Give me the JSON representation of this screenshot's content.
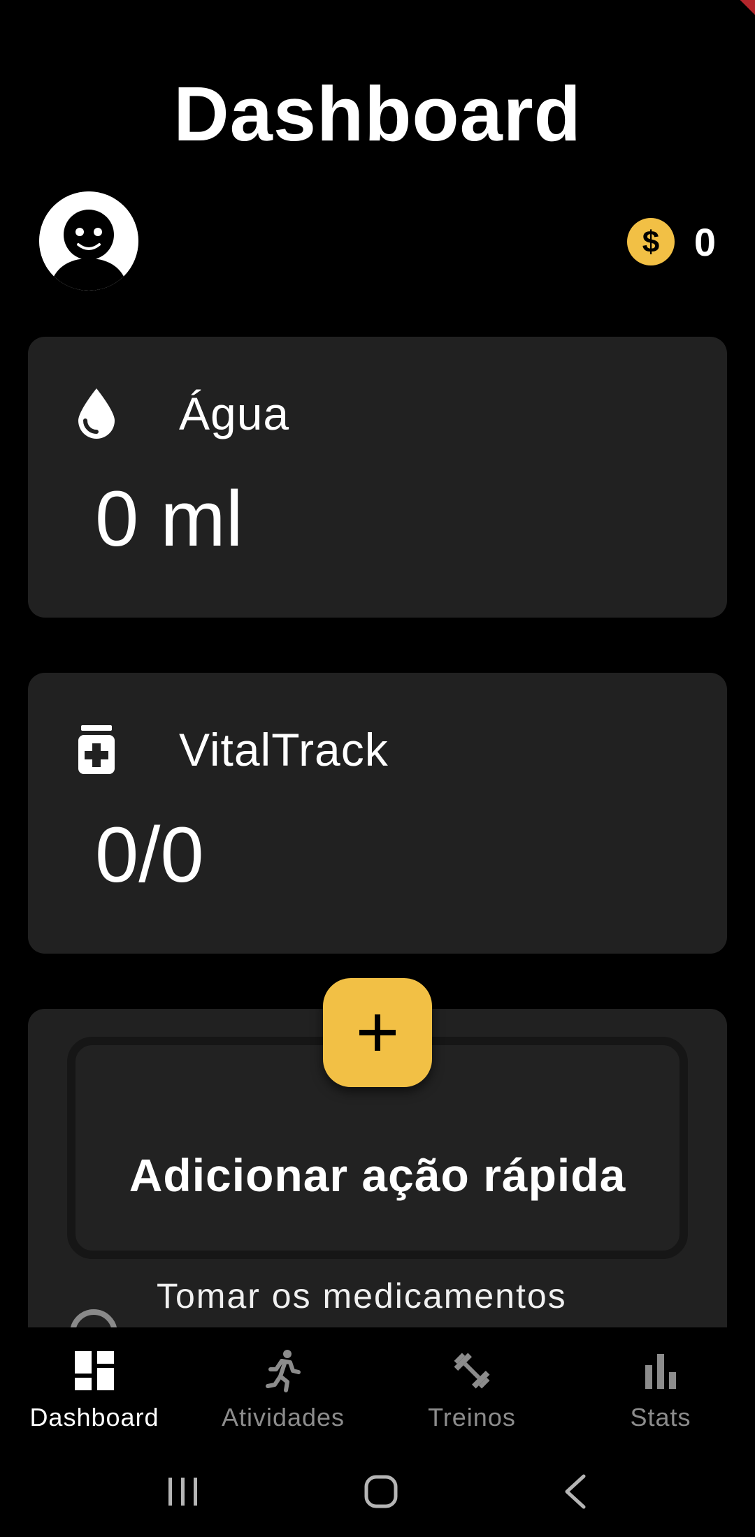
{
  "header": {
    "title": "Dashboard"
  },
  "profile": {
    "avatar_icon": "face-avatar-icon"
  },
  "coins": {
    "icon": "dollar-coin-icon",
    "count": "0",
    "color": "#f2c045"
  },
  "cards": {
    "water": {
      "icon": "water-drop-icon",
      "title": "Água",
      "value": "0 ml"
    },
    "meds": {
      "icon": "medication-icon",
      "title": "VitalTrack",
      "value": "0/0"
    }
  },
  "quick_actions": {
    "add_label": "Adicionar ação rápida",
    "fab_icon": "plus-icon",
    "tasks": [
      {
        "label": "Tomar os medicamentos",
        "checked": false
      }
    ]
  },
  "bottom_nav": {
    "items": [
      {
        "label": "Dashboard",
        "icon": "dashboard-icon",
        "active": true
      },
      {
        "label": "Atividades",
        "icon": "running-icon",
        "active": false
      },
      {
        "label": "Treinos",
        "icon": "dumbbell-icon",
        "active": false
      },
      {
        "label": "Stats",
        "icon": "bar-chart-icon",
        "active": false
      }
    ]
  },
  "system_nav": {
    "recents_icon": "recents-icon",
    "home_icon": "home-icon",
    "back_icon": "back-icon"
  },
  "theme": {
    "background": "#000000",
    "card": "#212121",
    "accent": "#f2c045"
  }
}
